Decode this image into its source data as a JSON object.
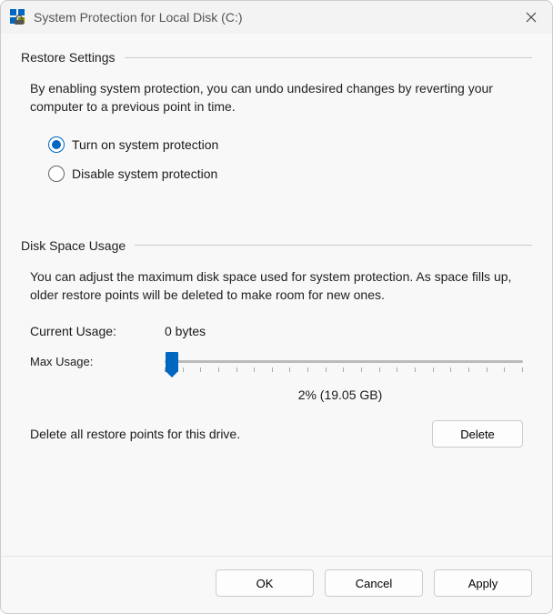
{
  "window": {
    "title": "System Protection for Local Disk (C:)"
  },
  "restore": {
    "heading": "Restore Settings",
    "description": "By enabling system protection, you can undo undesired changes by reverting your computer to a previous point in time.",
    "options": {
      "on": "Turn on system protection",
      "off": "Disable system protection"
    },
    "selected": "on"
  },
  "disk": {
    "heading": "Disk Space Usage",
    "description": "You can adjust the maximum disk space used for system protection. As space fills up, older restore points will be deleted to make room for new ones.",
    "current_label": "Current Usage:",
    "current_value": "0 bytes",
    "max_label": "Max Usage:",
    "slider_percent": 2,
    "slider_display": "2% (19.05 GB)",
    "delete_text": "Delete all restore points for this drive.",
    "delete_button": "Delete"
  },
  "buttons": {
    "ok": "OK",
    "cancel": "Cancel",
    "apply": "Apply"
  }
}
